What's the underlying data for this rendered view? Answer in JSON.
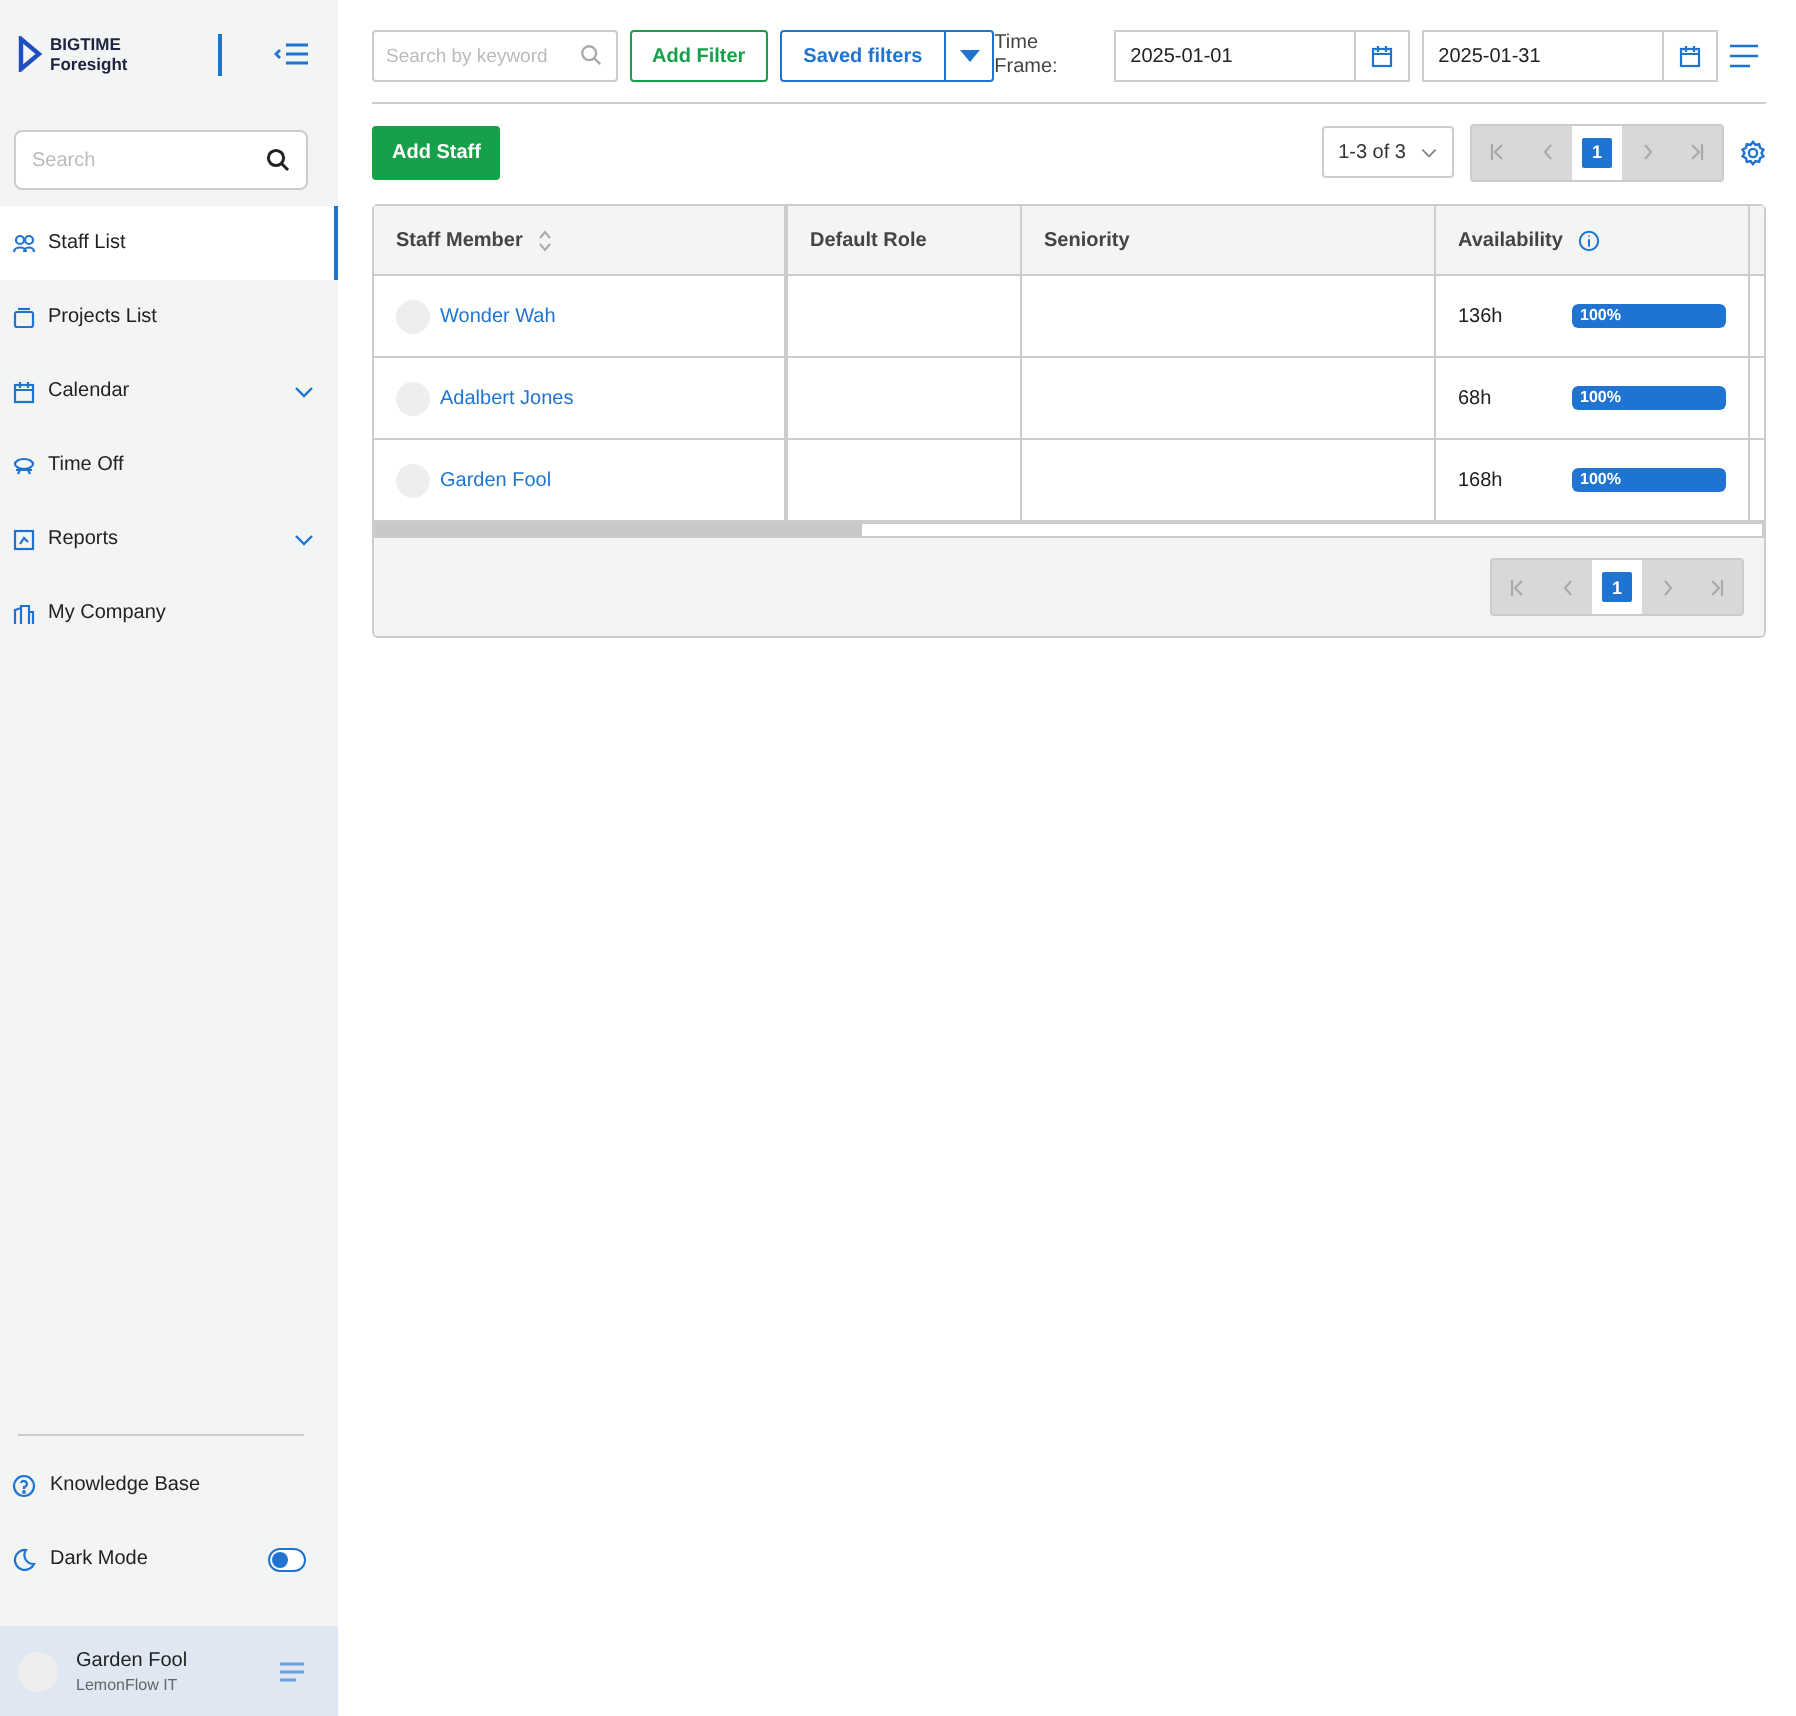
{
  "brand": {
    "line1": "BIGTIME",
    "line2": "Foresight"
  },
  "sidebar": {
    "search": {
      "placeholder": "Search"
    },
    "items": [
      {
        "label": "Staff List",
        "selected": true,
        "expandable": false
      },
      {
        "label": "Projects List",
        "selected": false,
        "expandable": false
      },
      {
        "label": "Calendar",
        "selected": false,
        "expandable": true
      },
      {
        "label": "Time Off",
        "selected": false,
        "expandable": false
      },
      {
        "label": "Reports",
        "selected": false,
        "expandable": true
      },
      {
        "label": "My Company",
        "selected": false,
        "expandable": false
      }
    ],
    "footer_items": [
      {
        "label": "Knowledge Base",
        "kind": "link"
      },
      {
        "label": "Dark Mode",
        "kind": "toggle",
        "on": false
      }
    ],
    "user": {
      "name": "Garden Fool",
      "company": "LemonFlow IT"
    }
  },
  "toolbar": {
    "search": {
      "placeholder": "Search by keyword"
    },
    "add_filter": "Add Filter",
    "saved_filters": "Saved filters",
    "time_frame_label": "Time Frame:",
    "date_from": "2025-01-01",
    "date_to": "2025-01-31"
  },
  "actions": {
    "add_staff": "Add Staff",
    "page_size": "1-3 of 3",
    "page": "1"
  },
  "table": {
    "columns": [
      {
        "label": "Staff Member",
        "sortable": true,
        "info": false
      },
      {
        "label": "Default Role",
        "sortable": false,
        "info": false
      },
      {
        "label": "Seniority",
        "sortable": false,
        "info": false
      },
      {
        "label": "Availability",
        "sortable": false,
        "info": true
      }
    ],
    "rows": [
      {
        "name": "Wonder Wah",
        "hours": "136h",
        "level": 1,
        "percent": "100%"
      },
      {
        "name": "Adalbert Jones",
        "hours": "68h",
        "level": 1,
        "percent": "100%"
      },
      {
        "name": "Garden Fool",
        "hours": "168h",
        "level": 1,
        "percent": "100%"
      }
    ],
    "footer_page": "1"
  }
}
